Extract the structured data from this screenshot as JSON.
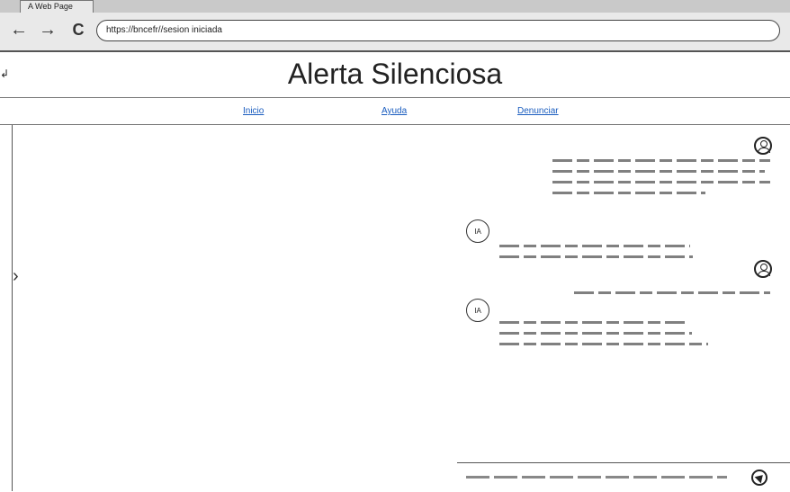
{
  "browser": {
    "tab_title": "A Web Page",
    "url": "https://bncefr//sesion iniciada",
    "back": "←",
    "forward": "→",
    "reload": "C"
  },
  "header": {
    "title": "Alerta Silenciosa"
  },
  "nav": {
    "items": [
      {
        "label": "Inicio"
      },
      {
        "label": "Ayuda"
      },
      {
        "label": "Denunciar"
      }
    ]
  },
  "chat": {
    "ai_avatar_label": "IA",
    "icons": {
      "user": "user-avatar-icon",
      "send": "send-icon",
      "expand": "chevron-right-icon"
    }
  }
}
